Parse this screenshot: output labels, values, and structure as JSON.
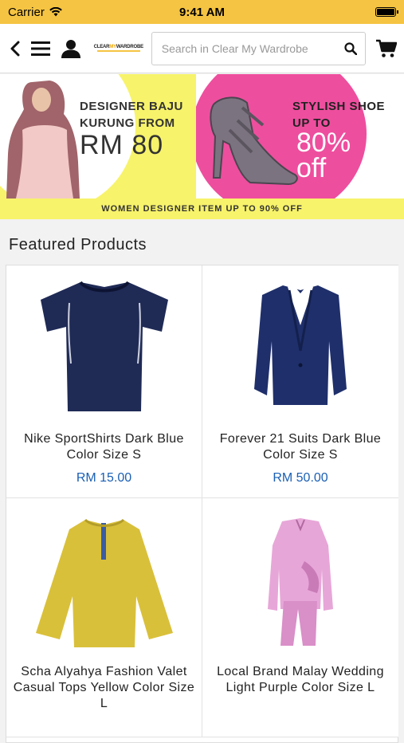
{
  "status_bar": {
    "carrier": "Carrier",
    "time": "9:41 AM",
    "battery_level": 1.0
  },
  "nav": {
    "logo_text_main": "CLEAR",
    "logo_text_accent": "MY",
    "logo_text_end": "WARDROBE",
    "search_placeholder": "Search in Clear My Wardrobe"
  },
  "banner": {
    "left_line1": "DESIGNER BAJU",
    "left_line2": "KURUNG FROM",
    "left_price": "RM 80",
    "right_line1": "STYLISH SHOE",
    "right_line2": "UP TO",
    "right_percent": "80%",
    "right_off": "off",
    "strip_text": "WOMEN DESIGNER ITEM UP TO 90% OFF",
    "colors": {
      "yellow": "#f7f36b",
      "pink": "#ee4e9e"
    }
  },
  "featured": {
    "title": "Featured Products",
    "products": [
      {
        "name": "Nike SportShirts Dark Blue Color Size S",
        "price": "RM 15.00",
        "icon": "tshirt-icon",
        "color": "#1f2a55"
      },
      {
        "name": "Forever 21 Suits Dark Blue Color Size S",
        "price": "RM 50.00",
        "icon": "blazer-icon",
        "color": "#1f2f6b"
      },
      {
        "name": "Scha Alyahya Fashion Valet Casual Tops Yellow Color Size L",
        "price": "",
        "icon": "blouse-icon",
        "color": "#d9c03a"
      },
      {
        "name": "Local Brand Malay Wedding Light Purple Color Size L",
        "price": "",
        "icon": "kurung-icon",
        "color": "#e7a6d8"
      }
    ]
  },
  "theme": {
    "accent": "#f5c442",
    "price_color": "#1a5fb4"
  }
}
